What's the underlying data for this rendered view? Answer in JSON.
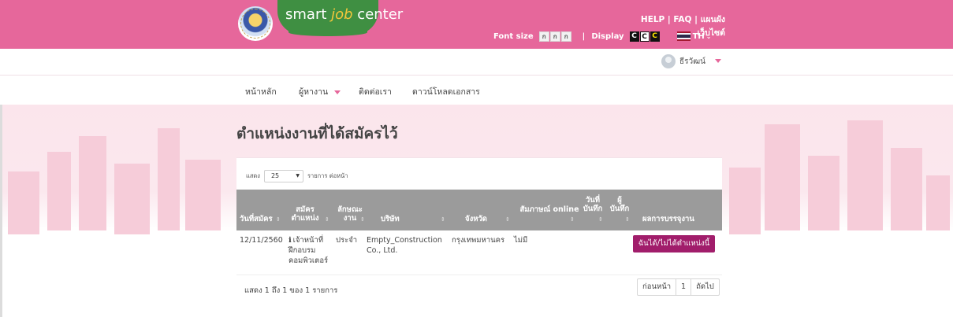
{
  "brand": {
    "logo_text_1": "smart ",
    "logo_text_2": "job",
    "logo_text_3": " center"
  },
  "header": {
    "links": [
      "HELP",
      "FAQ",
      "แผนผังเว็บไซต์"
    ],
    "font_size_label": "Font size",
    "font_size_buttons": [
      "ก",
      "ก",
      "ก"
    ],
    "display_label": "Display",
    "display_buttons": [
      "C",
      "C",
      "C"
    ],
    "lang": "TH"
  },
  "user": {
    "name": "ธีรวัฒน์"
  },
  "nav": {
    "items": [
      "หน้าหลัก",
      "ผู้หางาน",
      "ติดต่อเรา",
      "ดาวน์โหลดเอกสาร"
    ]
  },
  "page": {
    "title": "ตำแหน่งงานที่ได้สมัครไว้"
  },
  "table": {
    "length_prefix": "แสดง",
    "length_value": "25",
    "length_suffix": "รายการ ต่อหน้า",
    "columns": [
      "วันที่สมัคร",
      "สมัคร ตำแหน่ง",
      "ลักษณะ งาน",
      "บริษัท",
      "จังหวัด",
      "สัมภาษณ์ online",
      "วันที่ บันทึก",
      "ผู้ บันทึก",
      "ผลการบรรจุงาน"
    ],
    "rows": [
      {
        "date": "12/11/2560",
        "position": "เจ้าหน้าที่ ฝึกอบรม คอมพิวเตอร์",
        "type": "ประจำ",
        "company": "Empty_Construction Co., Ltd.",
        "province": "กรุงเทพมหานคร",
        "online_interview": "ไม่มี",
        "action": "ฉันได้/ไม่ได้ตำแหน่งนี้"
      }
    ],
    "info": "แสดง 1 ถึง 1 ของ 1 รายการ",
    "pager": {
      "prev": "ก่อนหน้า",
      "page": "1",
      "next": "ถัดไป"
    }
  },
  "colors": {
    "header_pink": "#e6679b",
    "logo_green": "#3f8f42",
    "table_header": "#9b9b9b",
    "action_button": "#a11d6b"
  }
}
